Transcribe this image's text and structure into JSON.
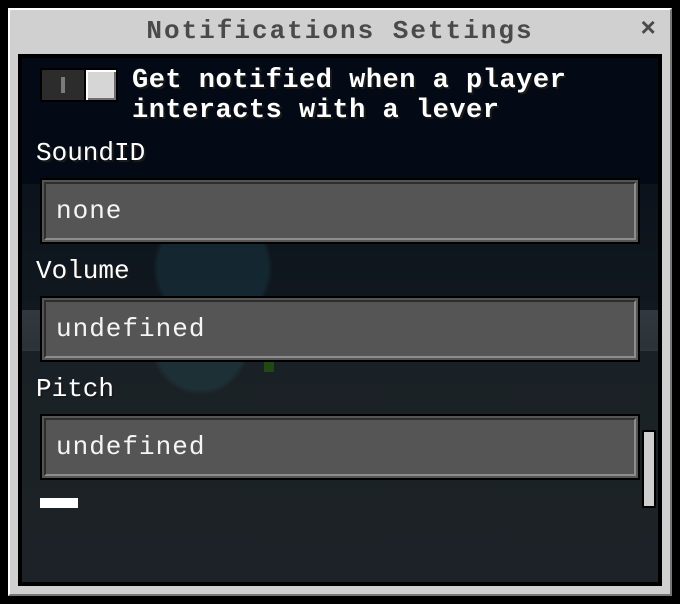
{
  "header": {
    "title": "Notifications Settings",
    "close_glyph": "×"
  },
  "toggle": {
    "label": "Get notified when a player interacts with a lever",
    "state": "off"
  },
  "fields": [
    {
      "label": "SoundID",
      "value": "none",
      "name": "soundid"
    },
    {
      "label": "Volume",
      "value": "undefined",
      "name": "volume"
    },
    {
      "label": "Pitch",
      "value": "undefined",
      "name": "pitch"
    }
  ]
}
